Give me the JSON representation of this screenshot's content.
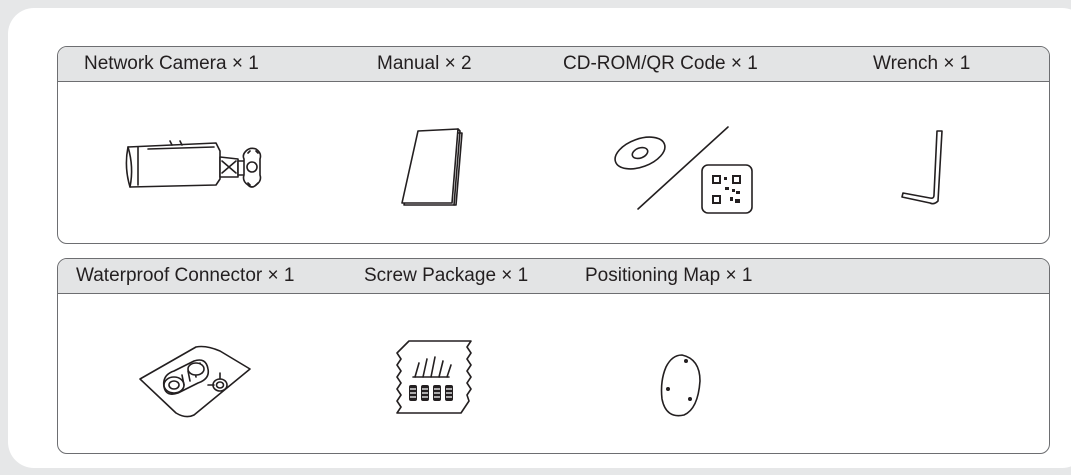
{
  "panels": {
    "top": {
      "items": [
        {
          "label": "Network Camera × 1",
          "icon": "network-camera-icon"
        },
        {
          "label": "Manual × 2",
          "icon": "manual-icon"
        },
        {
          "label": "CD-ROM/QR Code × 1",
          "icon": "cd-rom-qr-code-icon"
        },
        {
          "label": "Wrench × 1",
          "icon": "wrench-icon"
        }
      ]
    },
    "bottom": {
      "items": [
        {
          "label": "Waterproof Connector × 1",
          "icon": "waterproof-connector-icon"
        },
        {
          "label": "Screw Package × 1",
          "icon": "screw-package-icon"
        },
        {
          "label": "Positioning Map × 1",
          "icon": "positioning-map-icon"
        }
      ]
    }
  }
}
